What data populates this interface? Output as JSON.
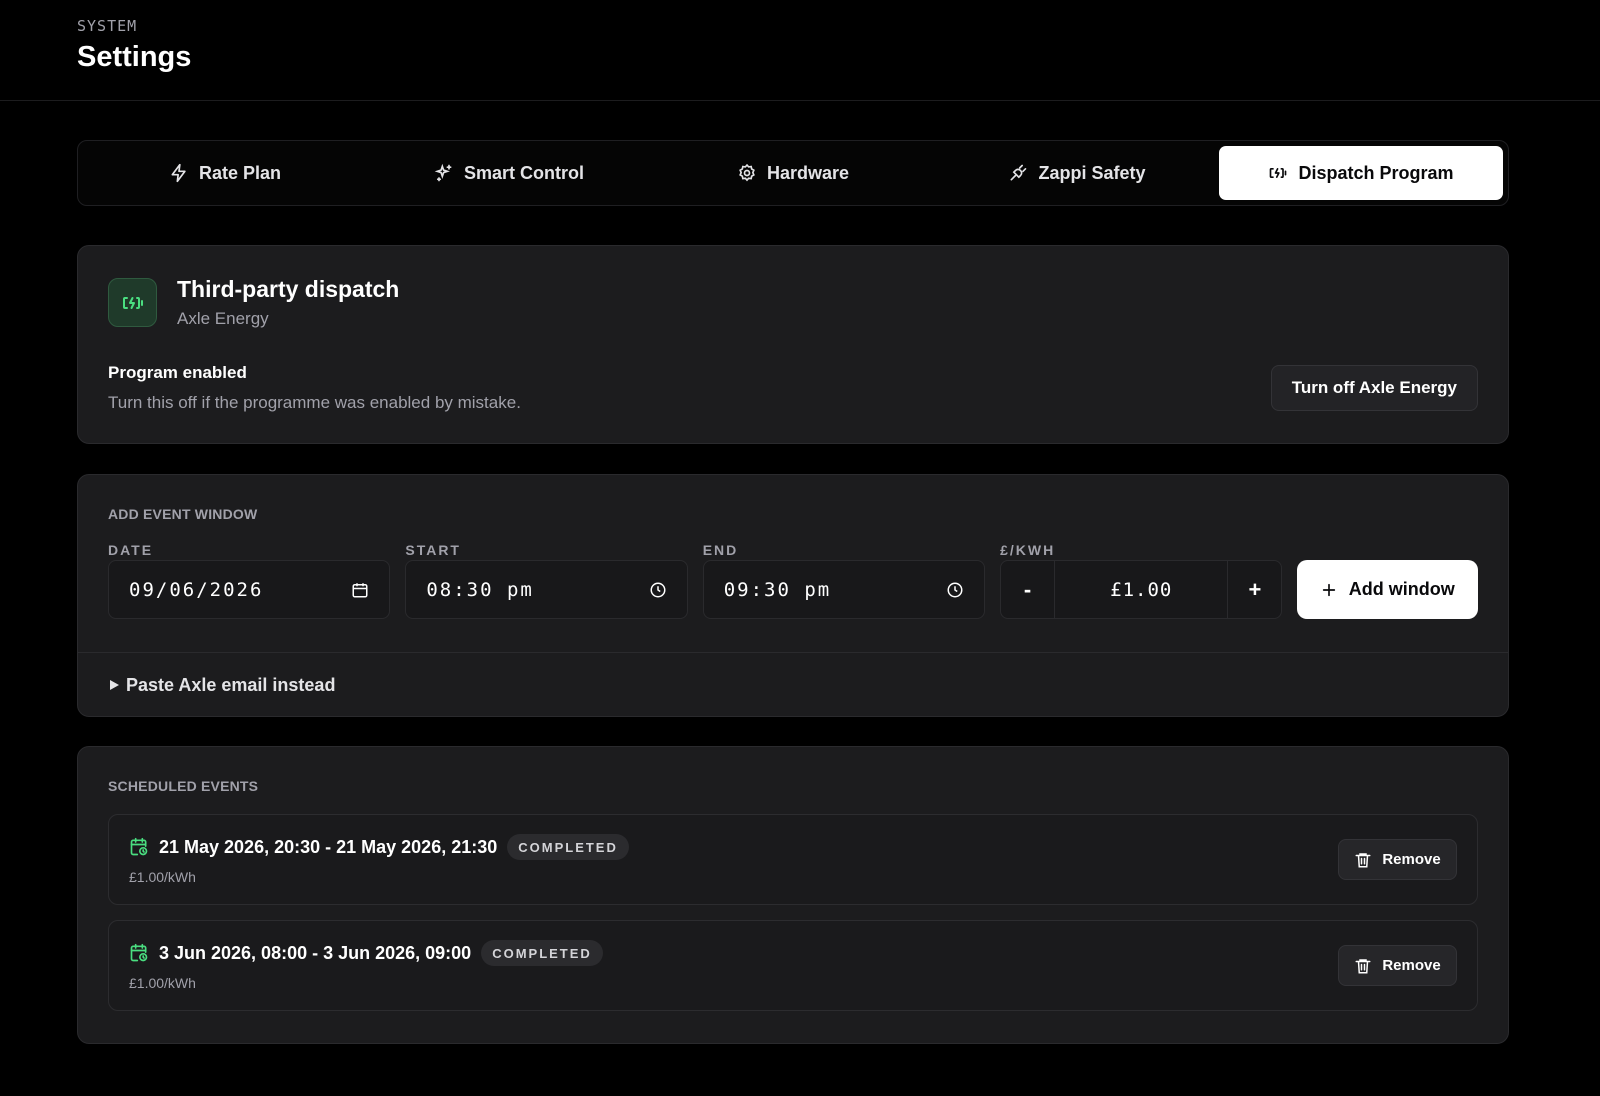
{
  "header": {
    "eyebrow": "SYSTEM",
    "title": "Settings"
  },
  "tabs": [
    {
      "label": "Rate Plan",
      "icon": "lightning-icon",
      "active": false
    },
    {
      "label": "Smart Control",
      "icon": "sparkles-icon",
      "active": false
    },
    {
      "label": "Hardware",
      "icon": "gear-icon",
      "active": false
    },
    {
      "label": "Zappi Safety",
      "icon": "plug-icon",
      "active": false
    },
    {
      "label": "Dispatch Program",
      "icon": "battery-charging-icon",
      "active": true
    }
  ],
  "program": {
    "title": "Third-party dispatch",
    "provider": "Axle Energy",
    "status_label": "Program enabled",
    "status_desc": "Turn this off if the programme was enabled by mistake.",
    "toggle_button": "Turn off Axle Energy",
    "accent_color": "#4ade80"
  },
  "add_event": {
    "section_label": "ADD EVENT WINDOW",
    "date": {
      "label": "DATE",
      "value": "09/06/2026"
    },
    "start": {
      "label": "START",
      "value": "08:30 pm"
    },
    "end": {
      "label": "END",
      "value": "09:30 pm"
    },
    "price": {
      "label": "£/KWH",
      "value": "£1.00",
      "minus": "-",
      "plus": "+"
    },
    "add_button": "Add window",
    "paste_toggle": "Paste Axle email instead"
  },
  "scheduled": {
    "section_label": "SCHEDULED EVENTS",
    "events": [
      {
        "range": "21 May 2026, 20:30 - 21 May 2026, 21:30",
        "status": "COMPLETED",
        "price": "£1.00/kWh",
        "remove": "Remove"
      },
      {
        "range": "3 Jun 2026, 08:00 - 3 Jun 2026, 09:00",
        "status": "COMPLETED",
        "price": "£1.00/kWh",
        "remove": "Remove"
      }
    ]
  }
}
